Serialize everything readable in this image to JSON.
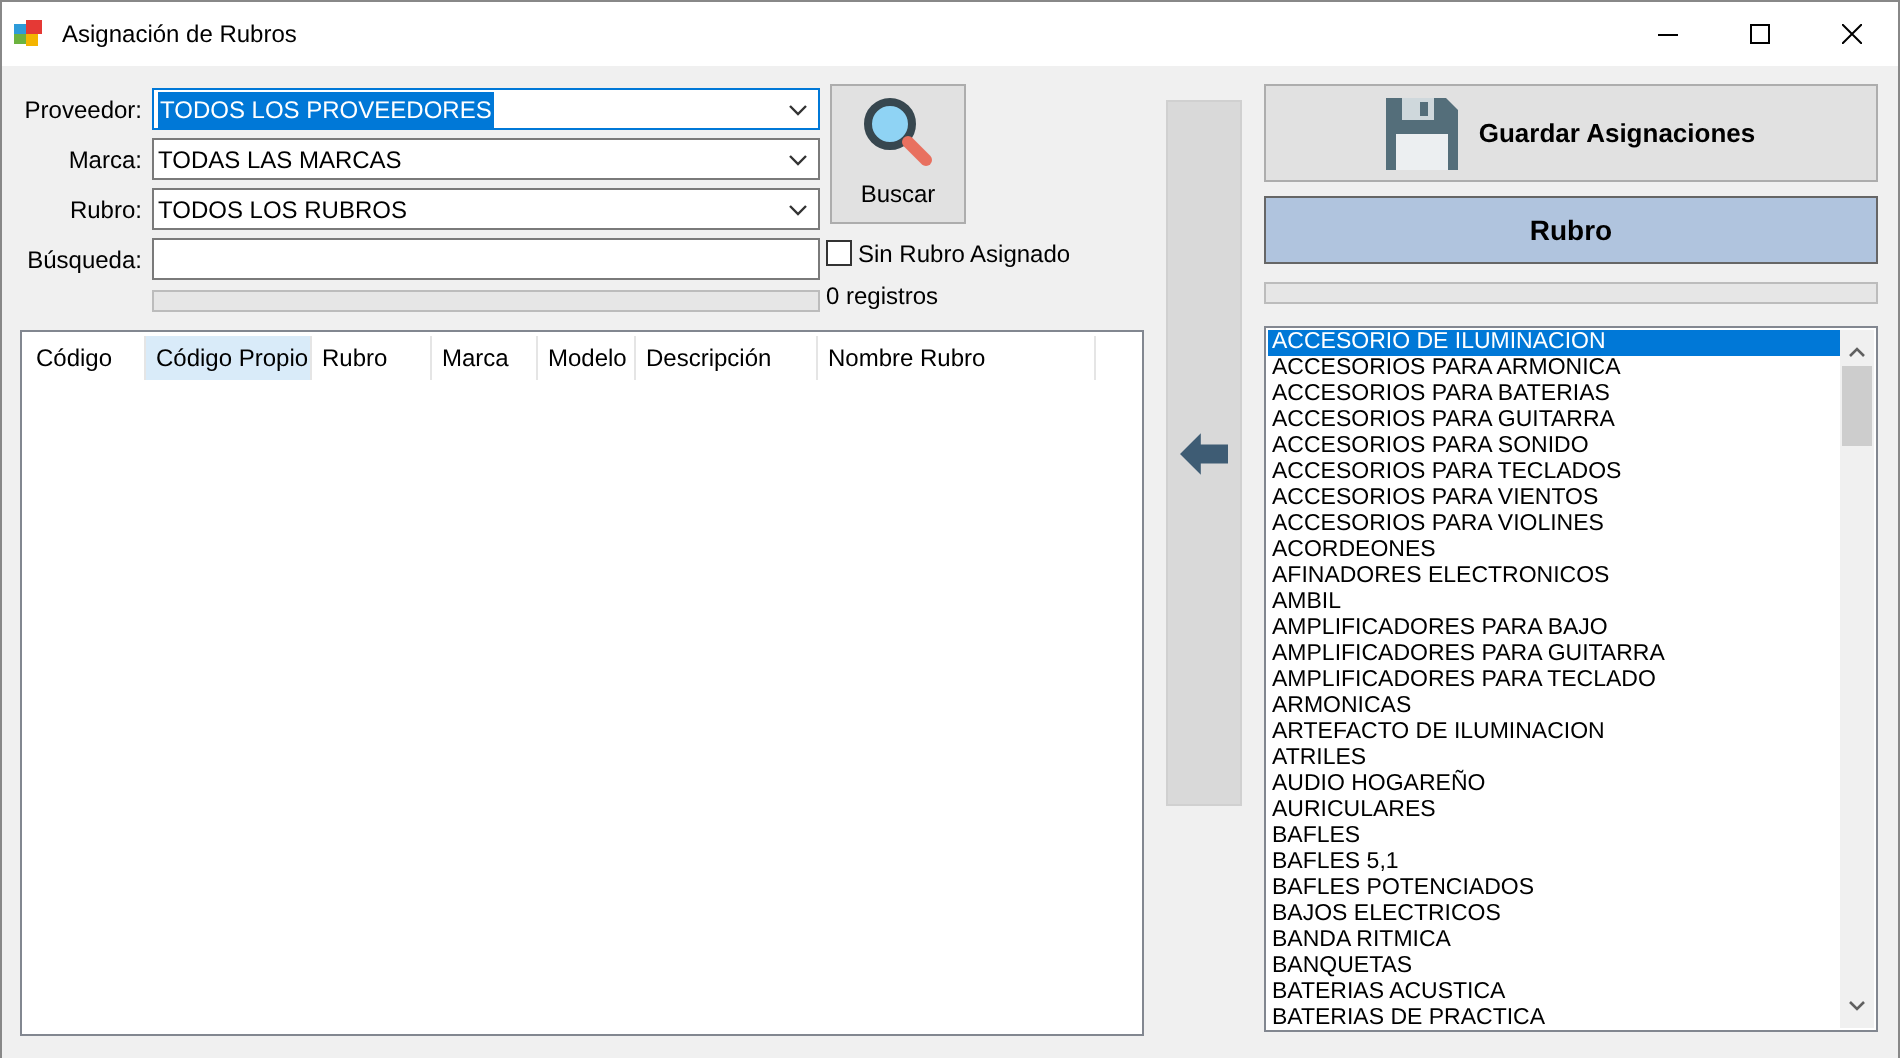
{
  "window": {
    "title": "Asignación de Rubros"
  },
  "filters": [
    {
      "kind": "combo",
      "label": "Proveedor:",
      "value": "TODOS LOS PROVEEDORES",
      "focused": true
    },
    {
      "kind": "combo",
      "label": "Marca:",
      "value": "TODAS LAS MARCAS",
      "focused": false
    },
    {
      "kind": "combo",
      "label": "Rubro:",
      "value": "TODOS LOS RUBROS",
      "focused": false
    },
    {
      "kind": "text",
      "label": "Búsqueda:",
      "focused": false
    }
  ],
  "search_button": {
    "label": "Buscar"
  },
  "unassigned_checkbox": {
    "label": "Sin Rubro Asignado",
    "checked": false
  },
  "progress": {
    "level": 0
  },
  "record_count": "0 registros",
  "table": {
    "columns": [
      {
        "label": "Código",
        "selected": false
      },
      {
        "label": "Código Propio",
        "selected": true
      },
      {
        "label": "Rubro",
        "selected": false
      },
      {
        "label": "Marca",
        "selected": false
      },
      {
        "label": "Modelo",
        "selected": false
      },
      {
        "label": "Descripción",
        "selected": false
      },
      {
        "label": "Nombre Rubro",
        "selected": false
      }
    ]
  },
  "save_button": {
    "label": "Guardar Asignaciones"
  },
  "rubro_header": "Rubro",
  "rubro_progress": {
    "level": 0
  },
  "rubros": [
    {
      "label": "ACCESORIO DE ILUMINACION",
      "selected": true
    },
    {
      "label": "ACCESORIOS PARA ARMONICA",
      "selected": false
    },
    {
      "label": "ACCESORIOS PARA BATERIAS",
      "selected": false
    },
    {
      "label": "ACCESORIOS PARA GUITARRA",
      "selected": false
    },
    {
      "label": "ACCESORIOS PARA SONIDO",
      "selected": false
    },
    {
      "label": "ACCESORIOS PARA TECLADOS",
      "selected": false
    },
    {
      "label": "ACCESORIOS PARA VIENTOS",
      "selected": false
    },
    {
      "label": "ACCESORIOS PARA VIOLINES",
      "selected": false
    },
    {
      "label": "ACORDEONES",
      "selected": false
    },
    {
      "label": "AFINADORES ELECTRONICOS",
      "selected": false
    },
    {
      "label": "AMBIL",
      "selected": false
    },
    {
      "label": "AMPLIFICADORES PARA BAJO",
      "selected": false
    },
    {
      "label": "AMPLIFICADORES PARA GUITARRA",
      "selected": false
    },
    {
      "label": "AMPLIFICADORES PARA TECLADO",
      "selected": false
    },
    {
      "label": "ARMONICAS",
      "selected": false
    },
    {
      "label": "ARTEFACTO DE ILUMINACION",
      "selected": false
    },
    {
      "label": "ATRILES",
      "selected": false
    },
    {
      "label": "AUDIO HOGAREÑO",
      "selected": false
    },
    {
      "label": "AURICULARES",
      "selected": false
    },
    {
      "label": "BAFLES",
      "selected": false
    },
    {
      "label": "BAFLES 5,1",
      "selected": false
    },
    {
      "label": "BAFLES POTENCIADOS",
      "selected": false
    },
    {
      "label": "BAJOS ELECTRICOS",
      "selected": false
    },
    {
      "label": "BANDA RITMICA",
      "selected": false
    },
    {
      "label": "BANQUETAS",
      "selected": false
    },
    {
      "label": "BATERIAS ACUSTICA",
      "selected": false
    },
    {
      "label": "BATERIAS DE PRACTICA",
      "selected": false
    }
  ]
}
